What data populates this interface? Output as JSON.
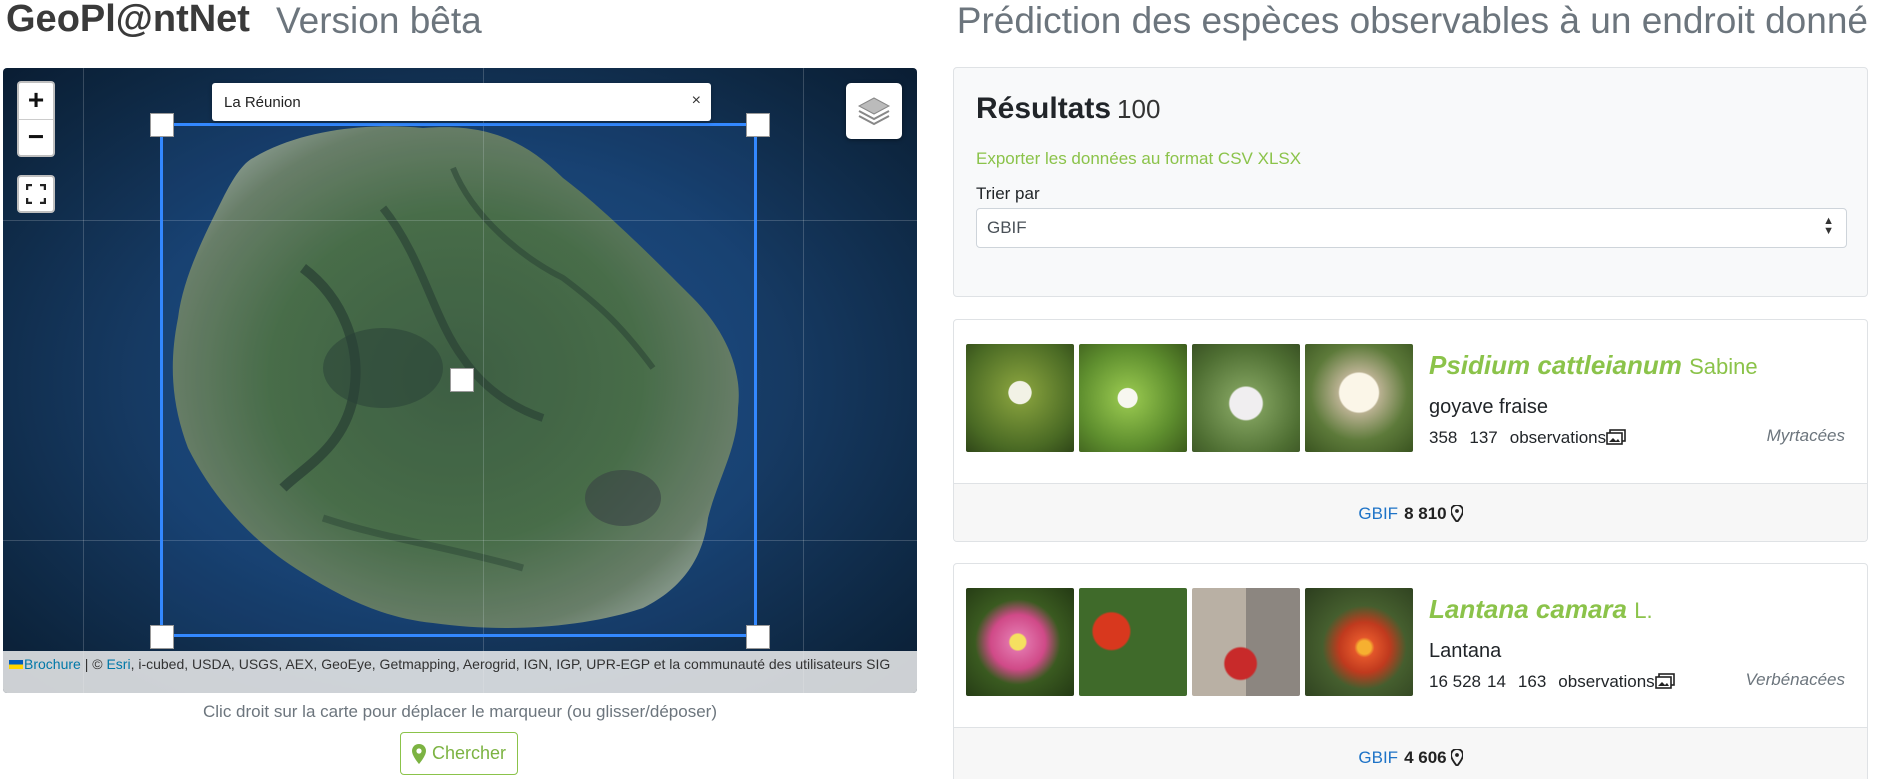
{
  "header": {
    "brand": "GeoPl@ntNet",
    "version": "Version bêta",
    "tagline": "Prédiction des espèces observables à un endroit donné"
  },
  "map": {
    "search_value": "La Réunion",
    "clear_symbol": "×",
    "zoom_in": "+",
    "zoom_out": "−",
    "attribution_prefix_link": "Brochure",
    "attribution_sep": " | © ",
    "attribution_esri": "Esri",
    "attribution_rest": ", i-cubed, USDA, USGS, AEX, GeoEye, Getmapping, Aerogrid, IGN, IGP, UPR-EGP et la communauté des utilisateurs SIG",
    "hint": "Clic droit sur la carte pour déplacer le marqueur (ou glisser/déposer)",
    "search_button": "Chercher",
    "icons": [
      "layers-icon",
      "fullscreen-icon",
      "map-marker-icon"
    ]
  },
  "results": {
    "title": "Résultats",
    "count": "100",
    "export_prefix": "Exporter les données au format",
    "export_csv": "CSV",
    "export_xlsx": "XLSX",
    "sort_label": "Trier par",
    "sort_value": "GBIF"
  },
  "species": [
    {
      "name": "Psidium cattleianum",
      "author": "Sabine",
      "common": "goyave fraise",
      "stat1": "358",
      "stat2": "137",
      "obs_label": "observations",
      "family": "Myrtacées",
      "source": "GBIF",
      "count": "8 810",
      "photo_colors": [
        "#5a7a2e",
        "#6f9a3a",
        "#6d8f4a",
        "#4f6d2a"
      ]
    },
    {
      "name": "Lantana camara",
      "author": "L.",
      "common": "Lantana",
      "stat1": "16 528",
      "stat1b": "14",
      "stat2": "163",
      "obs_label": "observations",
      "family": "Verbénacées",
      "source": "GBIF",
      "count": "4 606",
      "photo_colors": [
        "#c85a8a",
        "#b93a2a",
        "#9a8a7a",
        "#a34a2a"
      ]
    }
  ]
}
